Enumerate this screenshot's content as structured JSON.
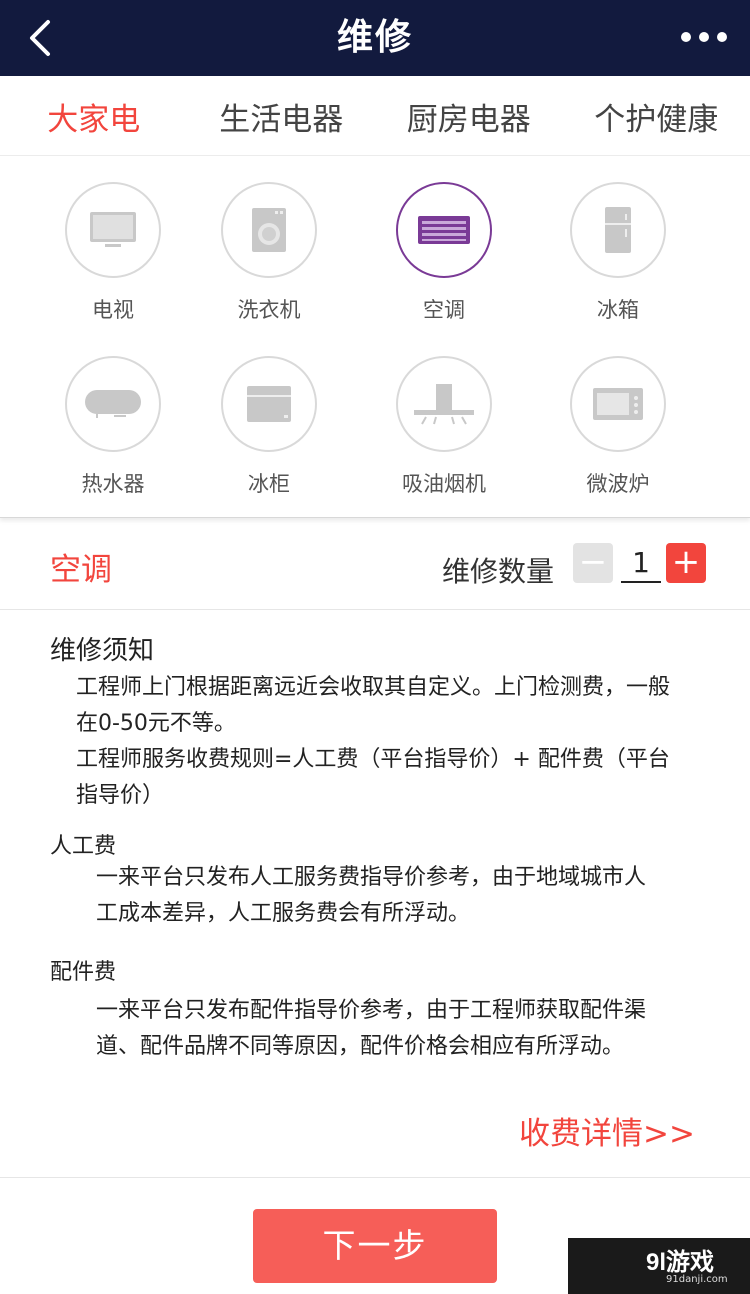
{
  "header": {
    "title": "维修"
  },
  "tabs": [
    {
      "label": "大家电",
      "active": true
    },
    {
      "label": "生活电器",
      "active": false
    },
    {
      "label": "厨房电器",
      "active": false
    },
    {
      "label": "个护健康",
      "active": false
    }
  ],
  "categories": [
    {
      "label": "电视",
      "icon": "tv-icon"
    },
    {
      "label": "洗衣机",
      "icon": "washing-machine-icon"
    },
    {
      "label": "空调",
      "icon": "air-conditioner-icon",
      "selected": true
    },
    {
      "label": "冰箱",
      "icon": "refrigerator-icon"
    },
    {
      "label": "热水器",
      "icon": "water-heater-icon"
    },
    {
      "label": "冰柜",
      "icon": "freezer-icon"
    },
    {
      "label": "吸油烟机",
      "icon": "range-hood-icon"
    },
    {
      "label": "微波炉",
      "icon": "microwave-icon"
    }
  ],
  "selection": {
    "name": "空调",
    "quantity_label": "维修数量",
    "quantity": "1",
    "minus": "−",
    "plus": "+"
  },
  "notice": {
    "title": "维修须知",
    "p1": "工程师上门根据距离远近会收取其自定义。上门检测费，一般在0-50元不等。",
    "p2": "工程师服务收费规则=人工费（平台指导价）+ 配件费（平台指导价）",
    "labor_title": "人工费",
    "labor_text": "一来平台只发布人工服务费指导价参考，由于地域城市人工成本差异，人工服务费会有所浮动。",
    "parts_title": "配件费",
    "parts_text": "一来平台只发布配件指导价参考，由于工程师获取配件渠道、配件品牌不同等原因，配件价格会相应有所浮动。",
    "detail_link": "收费详情>>"
  },
  "next_button": "下一步",
  "watermark": {
    "main": "9l游戏",
    "sub": "91danji.com"
  },
  "colors": {
    "header_bg": "#121a3e",
    "accent_red": "#f2453d",
    "selected_border": "#7a3a96",
    "button_bg": "#f65e58"
  }
}
